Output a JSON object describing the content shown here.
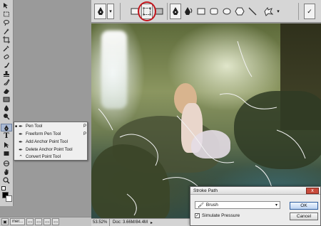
{
  "flyout_menu": {
    "items": [
      {
        "label": "Pen Tool",
        "shortcut": "P",
        "icon": "pen-icon",
        "selected": true
      },
      {
        "label": "Freeform Pen Tool",
        "shortcut": "P",
        "icon": "freeform-pen-icon",
        "selected": false
      },
      {
        "label": "Add Anchor Point Tool",
        "shortcut": "",
        "icon": "add-anchor-icon",
        "selected": false
      },
      {
        "label": "Delete Anchor Point Tool",
        "shortcut": "",
        "icon": "delete-anchor-icon",
        "selected": false
      },
      {
        "label": "Convert Point Tool",
        "shortcut": "",
        "icon": "convert-point-icon",
        "selected": false
      }
    ]
  },
  "stroke_dialog": {
    "title": "Stroke Path",
    "close_label": "x",
    "tool_value": "Brush",
    "simulate_pressure_label": "Simulate Pressure",
    "simulate_pressure_checked": true,
    "ok_label": "OK",
    "cancel_label": "Cancel"
  },
  "status_bar": {
    "zoom": "53.52%",
    "doc_size": "Doc: 3.66M/84.4M"
  },
  "taskbar": {
    "items": [
      "mer..."
    ]
  },
  "colors": {
    "highlight": "#c4141c",
    "tool_active": "#a9b9d4"
  }
}
